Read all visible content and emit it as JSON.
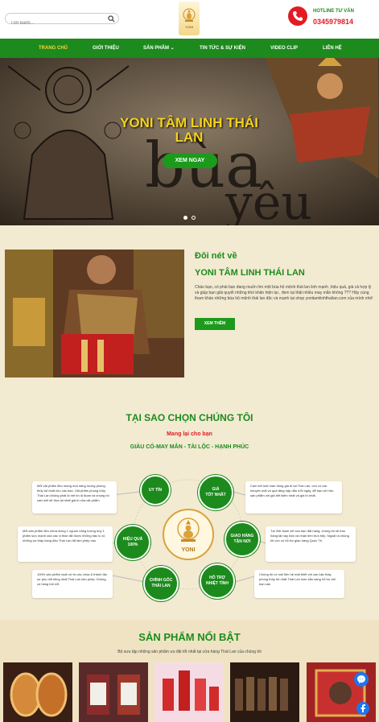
{
  "header": {
    "search_placeholder": "Tìm kiếm...",
    "logo_text": "YONI",
    "hotline_label": "HOTLINE TƯ VẤN",
    "hotline_number": "0345979814"
  },
  "nav": {
    "items": [
      {
        "label": "TRANG CHỦ",
        "active": true
      },
      {
        "label": "GIỚI THIỆU"
      },
      {
        "label": "SẢN PHẨM ⌄"
      },
      {
        "label": "TIN TỨC & SỰ KIỆN"
      },
      {
        "label": "VIDEO CLIP"
      },
      {
        "label": "LIÊN HỆ"
      }
    ]
  },
  "hero": {
    "title": "YONI TÂM LINH THÁI LAN",
    "button": "XEM NGAY",
    "bg_words": [
      "bùa",
      "yêu"
    ]
  },
  "about": {
    "kicker": "Đôi nét về",
    "title": "YONI TÂM LINH THÁI LAN",
    "text": "Chào bạn, có phải bạn đang muốn tìm một bùa hộ mệnh thái lan linh mạnh ,hiệu quả, giá cả hợp lý và giúp bạn giải quyết những khó khăn hiện tại , đem lại thật nhiều may mắn không ??? Hãy cùng tham khảo những bùa hộ mệnh thái lan độc và mạnh tại shop yonitamlinhthailan.com của mình nhé!",
    "button": "XEM THÊM"
  },
  "why": {
    "title": "TẠI SAO CHỌN CHÚNG TÔI",
    "subtitle": "Mang lại cho bạn",
    "tagline": "GIÀU CÓ-MAY MẮN - TÀI LỘC - HẠNH PHÚC",
    "center_logo": "YONI",
    "nodes": {
      "uy_tin": [
        "UY TÍN"
      ],
      "gia": [
        "GIÁ",
        "TỐT NHẤT"
      ],
      "hieu_qua": [
        "HIỆU QUẢ",
        "100%"
      ],
      "giao_hang": [
        "GIAO HÀNG",
        "TẬN NƠI"
      ],
      "chinh_goc": [
        "CHÍNH GỐC",
        "THÁI LAN"
      ],
      "ho_tro": [
        "HỖ TRỢ",
        "NHIỆT TÌNH"
      ]
    },
    "cards": {
      "uy_tin": "Mỗi vật phẩm đều mang một năng lượng phong thủy tốt nhất cho các bạn. Vật phẩm phong thủy Thái Lan không phải là mê tín dị đoan và chúng tôi cam kết sẽ đưa lại nhất giá trị của vật phẩm",
      "gia": "Cam kết luôn bán đúng giá trị tại Thái Lan, còn có các khuyến mãi vô quà tặng hấp dẫn mỗi ngày, để bạn sở hữu sản phẩm với giá tiết kiệm nhất và giá trị nhất.",
      "hieu_qua": "Mỗi sản phẩm đều chứa đựng 1 nguồn năng lượng huy 1 phẩm sức mạnh của các vị thần đã được những bậc tu sĩ, những sư thầy hàng đầu Thái Lan đã làm phép vào",
      "giao_hang": "Tại Việt Nam chỉ cần bạn đặt hàng, chúng tôi sẽ trao hàng tận tay bạn và nhận tiền trực tiếp. Ngoài ra chúng tôi còn có hỗ trợ giao hàng Quốc Tế.",
      "chinh_goc": "100% sản phẩm xuất xứ từ các chùa & thánh địa sư phụ nổi tiếng nhất Thái Lan làm phép. Không có hàng trôi nổi",
      "ho_tro": "Chúng tôi có mối liên hệ mật thiết với các bậc thầy phong thủy tốt nhất Thái Lan luôn sẵn sàng hỗ trợ khi bạn cần"
    }
  },
  "featured": {
    "title": "SẢN PHẨM NỔI BẬT",
    "subtitle": "Bộ sưu tập những sản phẩm ưu đãi tốt nhất tại cửa hàng Thái Lan của chúng tôi",
    "products": [
      "amulet-pendants",
      "oil-bottles-yantra",
      "red-oil-bottles",
      "small-bottles",
      "shrine-box"
    ]
  },
  "colors": {
    "green": "#1c8a1c",
    "red": "#e31b23",
    "yellow": "#f6d21b",
    "bg": "#f3ead2"
  }
}
